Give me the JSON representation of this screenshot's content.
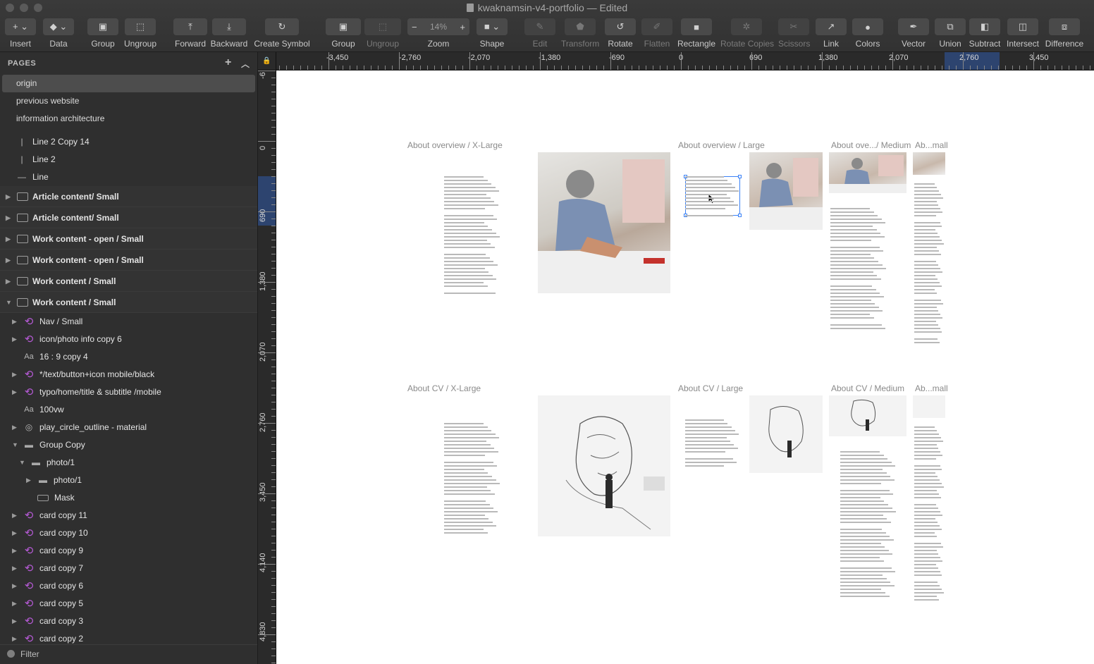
{
  "window": {
    "title": "kwaknamsin-v4-portfolio — Edited"
  },
  "toolbar": {
    "insert": "Insert",
    "data": "Data",
    "group": "Group",
    "ungroup": "Ungroup",
    "forward": "Forward",
    "backward": "Backward",
    "create_symbol": "Create Symbol",
    "group2": "Group",
    "ungroup2": "Ungroup",
    "zoom": "Zoom",
    "zoom_value": "14%",
    "shape": "Shape",
    "edit": "Edit",
    "transform": "Transform",
    "rotate": "Rotate",
    "flatten": "Flatten",
    "rectangle": "Rectangle",
    "rotate_copies": "Rotate Copies",
    "scissors": "Scissors",
    "link": "Link",
    "colors": "Colors",
    "vector": "Vector",
    "union": "Union",
    "subtract": "Subtract",
    "intersect": "Intersect",
    "difference": "Difference"
  },
  "sidebar": {
    "pages_header": "PAGES",
    "pages": [
      "origin",
      "previous website",
      "information architecture"
    ],
    "layers": [
      {
        "label": "Line 2 Copy 14",
        "icon": "line-icon",
        "type": "plain"
      },
      {
        "label": "Line 2",
        "icon": "line-icon",
        "type": "plain"
      },
      {
        "label": "Line",
        "icon": "line-icon",
        "type": "plain"
      },
      {
        "label": "Article content/ Small",
        "icon": "artboard-icon",
        "type": "artboard"
      },
      {
        "label": "Article content/ Small",
        "icon": "artboard-icon",
        "type": "artboard"
      },
      {
        "label": "Work content - open / Small",
        "icon": "artboard-icon",
        "type": "artboard"
      },
      {
        "label": "Work content - open / Small",
        "icon": "artboard-icon",
        "type": "artboard"
      },
      {
        "label": "Work content / Small",
        "icon": "artboard-icon",
        "type": "artboard"
      },
      {
        "label": "Work content / Small",
        "icon": "artboard-icon",
        "type": "artboard-open"
      },
      {
        "label": "Nav / Small",
        "icon": "symbol-icon",
        "type": "symbol"
      },
      {
        "label": "icon/photo info copy 6",
        "icon": "symbol-icon",
        "type": "symbol"
      },
      {
        "label": "16 : 9 copy 4",
        "icon": "text-icon",
        "type": "text"
      },
      {
        "label": "*/text/button+icon mobile/black",
        "icon": "symbol-icon",
        "type": "symbol"
      },
      {
        "label": "typo/home/title & subtitle /mobile",
        "icon": "symbol-icon",
        "type": "symbol"
      },
      {
        "label": "100vw",
        "icon": "text-icon",
        "type": "text"
      },
      {
        "label": "play_circle_outline - material",
        "icon": "circle-icon",
        "type": "symbol"
      },
      {
        "label": "Group Copy",
        "icon": "folder-icon",
        "type": "folder-open"
      },
      {
        "label": "photo/1",
        "icon": "folder-icon",
        "type": "folder-open-2"
      },
      {
        "label": "photo/1",
        "icon": "folder-icon",
        "type": "folder-3"
      },
      {
        "label": "Mask",
        "icon": "rect-icon",
        "type": "mask"
      },
      {
        "label": "card copy 11",
        "icon": "symbol-icon",
        "type": "symbol"
      },
      {
        "label": "card copy 10",
        "icon": "symbol-icon",
        "type": "symbol"
      },
      {
        "label": "card copy 9",
        "icon": "symbol-icon",
        "type": "symbol"
      },
      {
        "label": "card copy 7",
        "icon": "symbol-icon",
        "type": "symbol"
      },
      {
        "label": "card copy 6",
        "icon": "symbol-icon",
        "type": "symbol"
      },
      {
        "label": "card copy 5",
        "icon": "symbol-icon",
        "type": "symbol"
      },
      {
        "label": "card copy 3",
        "icon": "symbol-icon",
        "type": "symbol"
      },
      {
        "label": "card copy 2",
        "icon": "symbol-icon",
        "type": "symbol"
      }
    ],
    "filter": "Filter"
  },
  "rulers": {
    "top": [
      "-3,450",
      "-2,760",
      "-2,070",
      "-1,380",
      "-690",
      "0",
      "690",
      "1,380",
      "2,070",
      "2,760",
      "3,450"
    ],
    "left": [
      "-6",
      "0",
      "690",
      "1,380",
      "2,070",
      "2,760",
      "3,450",
      "4,140",
      "4,830"
    ]
  },
  "canvas": {
    "artboards": [
      {
        "title": "About overview / X-Large"
      },
      {
        "title": "About overview / Large"
      },
      {
        "title": "About ove.../ Medium"
      },
      {
        "title": "Ab...mall"
      },
      {
        "title": "About CV / X-Large"
      },
      {
        "title": "About CV / Large"
      },
      {
        "title": "About CV / Medium"
      },
      {
        "title": "Ab...mall"
      }
    ]
  },
  "colors": {
    "selection": "#3b82f6",
    "symbol": "#b65ad6",
    "canvas": "#ffffff",
    "panel": "#2f2f2f"
  }
}
